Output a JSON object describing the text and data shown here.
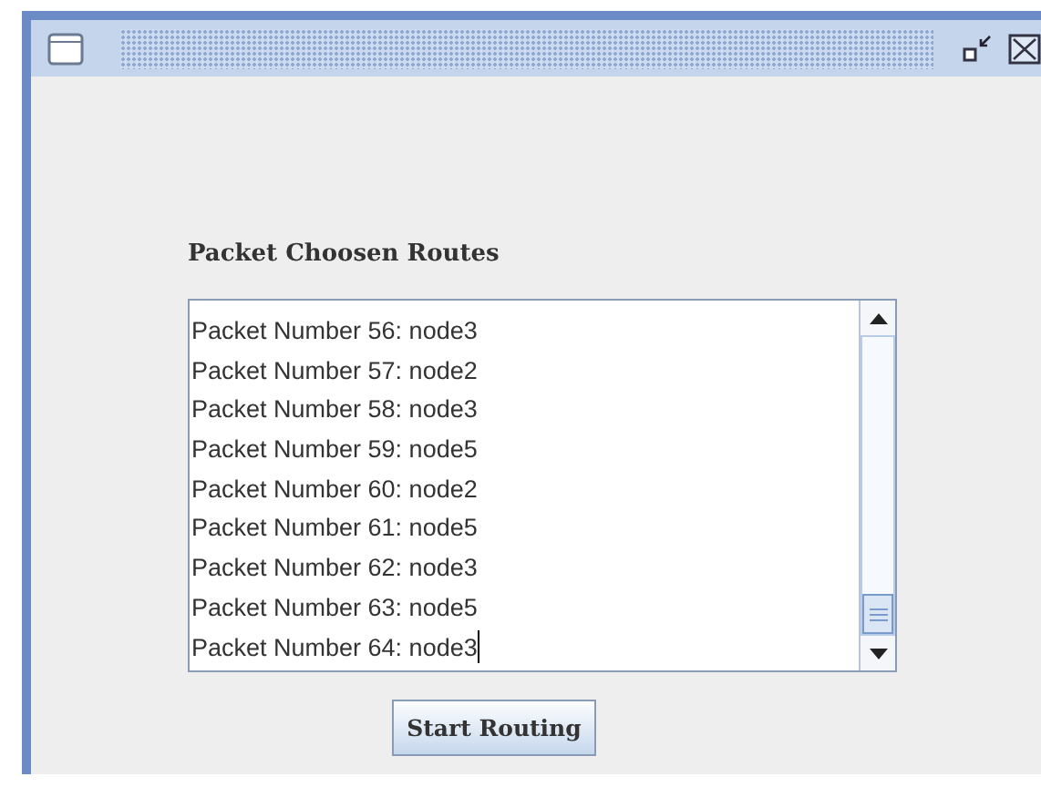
{
  "window": {
    "title_bar_buttons": [
      {
        "kind": "minimize"
      },
      {
        "kind": "close"
      }
    ]
  },
  "label": "Packet Choosen Routes",
  "text_area": {
    "lines": [
      "Packet Number 56: node3",
      "Packet Number 57: node2",
      "Packet Number 58: node3",
      "Packet Number 59: node5",
      "Packet Number 60: node2",
      "Packet Number 61: node5",
      "Packet Number 62: node3",
      "Packet Number 63: node5",
      "Packet Number 64: node3"
    ]
  },
  "button": "Start Routing"
}
